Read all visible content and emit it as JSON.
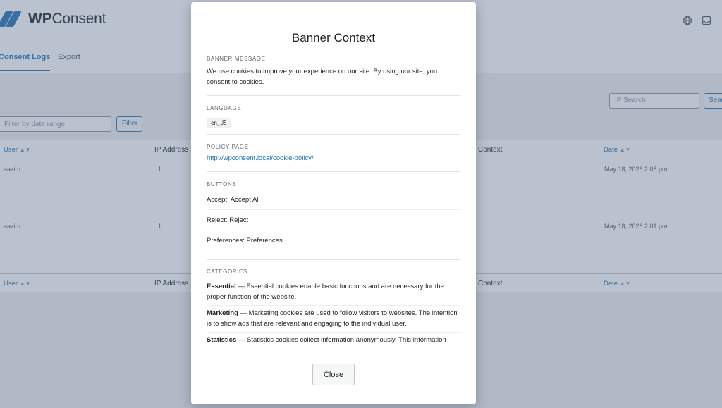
{
  "app": {
    "logo_bold": "WP",
    "logo_light": "Consent"
  },
  "header_icons": [
    "globe-icon",
    "inbox-icon"
  ],
  "tabs": [
    {
      "label": "Consent Logs",
      "active": true
    },
    {
      "label": "Export",
      "active": false
    }
  ],
  "filters": {
    "date_placeholder": "Filter by date range",
    "filter_label": "Filter",
    "ip_placeholder": "IP Search",
    "search_label": "Sear"
  },
  "table": {
    "columns": [
      "User",
      "IP Address",
      "Context",
      "Date"
    ],
    "rows": [
      {
        "user": "aazim",
        "ip": "::1",
        "date": "May 18, 2026 2:05 pm"
      },
      {
        "user": "aazim",
        "ip": "::1",
        "date": "May 18, 2026 2:01 pm"
      }
    ]
  },
  "modal": {
    "title": "Banner Context",
    "banner_message_heading": "BANNER MESSAGE",
    "banner_message": "We use cookies to improve your experience on our site. By using our site, you consent to cookies.",
    "language_heading": "LANGUAGE",
    "language": "en_US",
    "policy_heading": "POLICY PAGE",
    "policy_url": "http://wpconsent.local/cookie-policy/",
    "buttons_heading": "BUTTONS",
    "buttons": [
      "Accept: Accept All",
      "Reject: Reject",
      "Preferences: Preferences"
    ],
    "categories_heading": "CATEGORIES",
    "categories": [
      {
        "name": "Essential",
        "desc": " — Essential cookies enable basic functions and are necessary for the proper function of the website."
      },
      {
        "name": "Marketing",
        "desc": " — Marketing cookies are used to follow visitors to websites. The intention is to show ads that are relevant and engaging to the individual user."
      },
      {
        "name": "Statistics",
        "desc": " — Statistics cookies collect information anonymously. This information"
      }
    ],
    "close_label": "Close"
  },
  "colors": {
    "accent": "#2271b1",
    "overlay": "rgba(90,110,140,0.42)"
  }
}
